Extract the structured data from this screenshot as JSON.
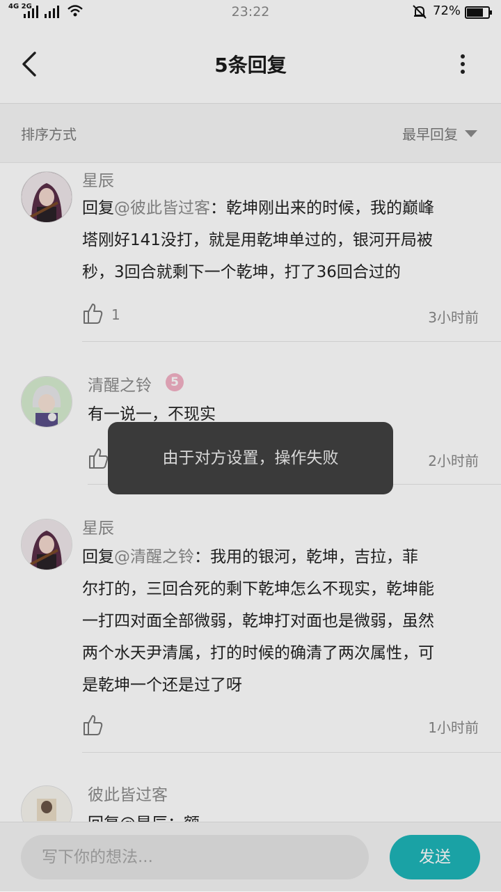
{
  "status_bar": {
    "network": "4G 2G",
    "network_2": "2G",
    "time": "23:22",
    "battery": "72%"
  },
  "header": {
    "title": "5条回复",
    "back_icon": "chevron-left-icon",
    "more_icon": "more-vertical-icon"
  },
  "sort": {
    "label": "排序方式",
    "value": "最早回复"
  },
  "replies": [
    {
      "user": "星辰",
      "reply_prefix": "回复",
      "mention": "@彼此皆过客",
      "text_line1": "：乾坤刚出来的时候，我的巅峰",
      "text_line2": "塔刚好141没打，就是用乾坤单过的，银河开局被",
      "text_line3": "秒，3回合就剩下一个乾坤，打了36回合过的",
      "likes": "1",
      "time": "3小时前"
    },
    {
      "user": "清醒之铃",
      "level": "5",
      "text": "有一说一，不现实",
      "time": "2小时前"
    },
    {
      "user": "星辰",
      "reply_prefix": "回复",
      "mention": "@清醒之铃",
      "text_line1": "：我用的银河，乾坤，吉拉，菲",
      "text_line2": "尔打的，三回合死的剩下乾坤怎么不现实，乾坤能",
      "text_line3": "一打四对面全部微弱，乾坤打对面也是微弱，虽然",
      "text_line4": "两个水天尹清属，打的时候的确清了两次属性，可",
      "text_line5": "是乾坤一个还是过了呀",
      "time": "1小时前"
    },
    {
      "user": "彼此皆过客",
      "text_partial": "回复@星辰：额"
    }
  ],
  "toast": "由于对方设置，操作失败",
  "bottom_bar": {
    "placeholder": "写下你的想法...",
    "send_label": "发送"
  },
  "colors": {
    "accent": "#1eb5b8",
    "toast_bg": "#3a3a3a"
  }
}
